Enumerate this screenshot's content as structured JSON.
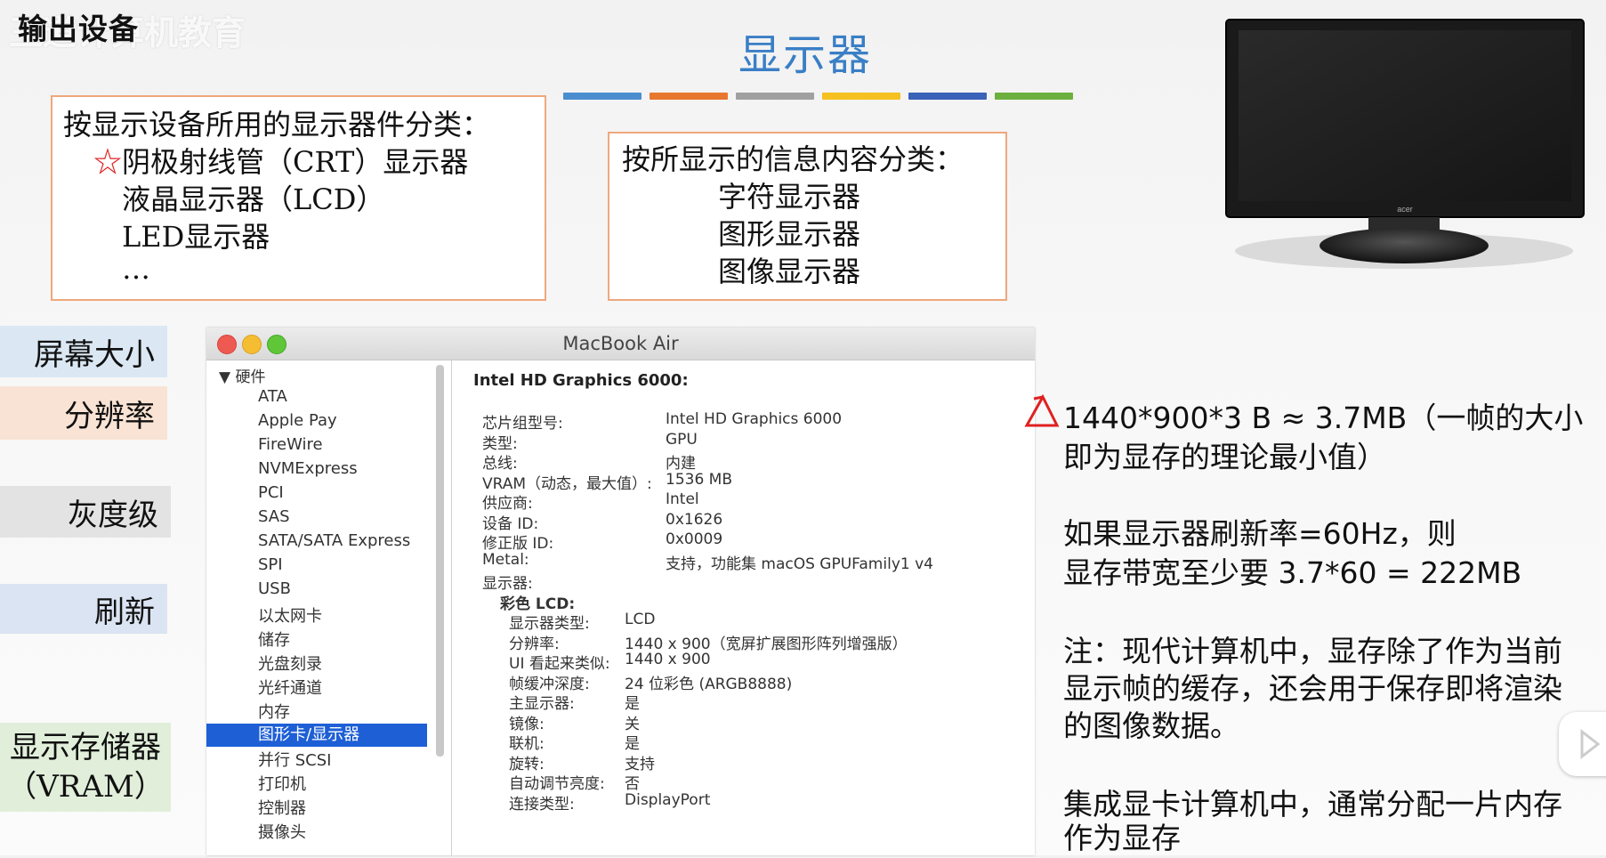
{
  "header": {
    "title": "输出设备",
    "watermark": "王道计算机教育"
  },
  "slide_title": "显示器",
  "color_bar": [
    "#4a8ed0",
    "#e87830",
    "#a0a0a0",
    "#f5c020",
    "#3a62b8",
    "#6cb040"
  ],
  "box_display_device": {
    "heading": "按显示设备所用的显示器件分类：",
    "star": "☆",
    "items": [
      "阴极射线管（CRT）显示器",
      "液晶显示器（LCD）",
      "LED显示器",
      "…"
    ]
  },
  "box_info_content": {
    "heading": "按所显示的信息内容分类：",
    "items": [
      "字符显示器",
      "图形显示器",
      "图像显示器"
    ]
  },
  "left_labels": {
    "screen_size": "屏幕大小",
    "resolution": "分辨率",
    "grayscale": "灰度级",
    "refresh": "刷新",
    "vram_line1": "显示存储器",
    "vram_line2": "（VRAM）"
  },
  "mac_window": {
    "title": "MacBook Air",
    "tree_root": "▼ 硬件",
    "sidebar_items": [
      "ATA",
      "Apple Pay",
      "FireWire",
      "NVMExpress",
      "PCI",
      "SAS",
      "SATA/SATA Express",
      "SPI",
      "USB",
      "以太网卡",
      "储存",
      "光盘刻录",
      "光纤通道",
      "内存",
      "图形卡/显示器",
      "并行 SCSI",
      "打印机",
      "控制器",
      "摄像头"
    ],
    "selected_index": 14,
    "device_title": "Intel HD Graphics 6000:",
    "properties": [
      {
        "key": "芯片组型号:",
        "value": "Intel HD Graphics 6000"
      },
      {
        "key": "类型:",
        "value": "GPU"
      },
      {
        "key": "总线:",
        "value": "内建"
      },
      {
        "key": "VRAM（动态，最大值）:",
        "value": "1536 MB"
      },
      {
        "key": "供应商:",
        "value": "Intel"
      },
      {
        "key": "设备 ID:",
        "value": "0x1626"
      },
      {
        "key": "修正版 ID:",
        "value": "0x0009"
      },
      {
        "key": "Metal:",
        "value": "支持，功能集 macOS GPUFamily1 v4"
      },
      {
        "key": "显示器:",
        "value": ""
      }
    ],
    "display_group": "彩色 LCD:",
    "display_properties": [
      {
        "key": "显示器类型:",
        "value": "LCD"
      },
      {
        "key": "分辨率:",
        "value": "1440 x 900（宽屏扩展图形阵列增强版）"
      },
      {
        "key": "UI 看起来类似:",
        "value": "1440 x 900"
      },
      {
        "key": "帧缓冲深度:",
        "value": "24 位彩色 (ARGB8888)"
      },
      {
        "key": "主显示器:",
        "value": "是"
      },
      {
        "key": "镜像:",
        "value": "关"
      },
      {
        "key": "联机:",
        "value": "是"
      },
      {
        "key": "旋转:",
        "value": "支持"
      },
      {
        "key": "自动调节亮度:",
        "value": "否"
      },
      {
        "key": "连接类型:",
        "value": "DisplayPort"
      }
    ]
  },
  "monitor_brand": "acer",
  "notes": {
    "calc_line1": "1440*900*3 B ≈ 3.7MB（一帧的大小",
    "calc_line2": "即为显存的理论最小值）",
    "refresh_line1": "如果显示器刷新率=60Hz，则",
    "refresh_line2": "显存带宽至少要 3.7*60 = 222MB",
    "modern_line1": "注：现代计算机中，显存除了作为当前",
    "modern_line2": "显示帧的缓存，还会用于保存即将渲染",
    "modern_line3": "的图像数据。",
    "integrated_line1": "集成显卡计算机中，通常分配一片内存",
    "integrated_line2": "作为显存"
  }
}
